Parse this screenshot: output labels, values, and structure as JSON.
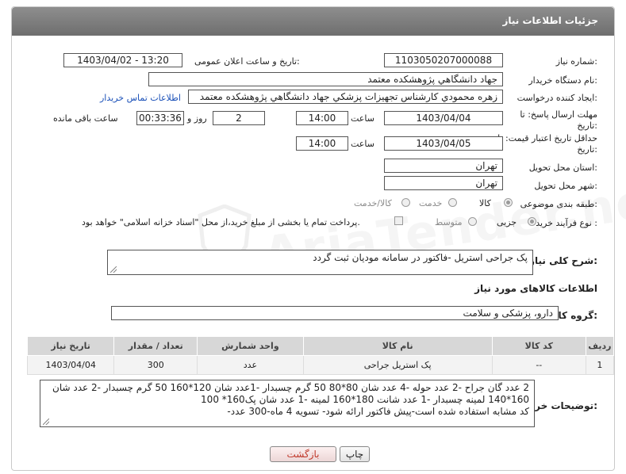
{
  "header": {
    "title": "جزئیات اطلاعات نیاز"
  },
  "form": {
    "need_number": {
      "label": "شماره نیاز:",
      "value": "1103050207000088"
    },
    "announce_datetime": {
      "label": "تاریخ و ساعت اعلان عمومی:",
      "value": "1403/04/02 - 13:20"
    },
    "buyer_org": {
      "label": "نام دستگاه خریدار:",
      "value": "جهاد دانشگاهي پژوهشکده معتمد"
    },
    "requester": {
      "label": "ایجاد کننده درخواست:",
      "value": "زهره محمودي کارشناس تجهیزات پزشکي جهاد دانشگاهي پژوهشکده معتمد",
      "contact_link": "اطلاعات تماس خریدار"
    },
    "reply_deadline": {
      "label_line1": "مهلت ارسال پاسخ: تا",
      "label_line2": "تاریخ:",
      "date": "1403/04/04",
      "time_label": "ساعت",
      "time": "14:00",
      "days": "2",
      "days_label": "روز و",
      "remaining": "00:33:36",
      "remaining_label": "ساعت باقی مانده"
    },
    "price_validity": {
      "label_line1": "حداقل تاریخ اعتبار قیمت: تا",
      "label_line2": "تاریخ:",
      "date": "1403/04/05",
      "time_label": "ساعت",
      "time": "14:00"
    },
    "delivery_province": {
      "label": "استان محل تحویل:",
      "value": "تهران"
    },
    "delivery_city": {
      "label": "شهر محل تحویل:",
      "value": "تهران"
    },
    "subject_class": {
      "label": "طبقه بندی موضوعی:",
      "options": [
        "کالا",
        "خدمت",
        "کالا/خدمت"
      ],
      "selected": "کالا"
    },
    "purchase_process": {
      "label": "نوع فرآیند خرید :",
      "options": [
        "جزیی",
        "متوسط"
      ],
      "selected": "جزیی",
      "payment_note": "پرداخت تمام یا بخشی از مبلغ خرید،از محل \"اسناد خزانه اسلامی\" خواهد بود."
    },
    "general_desc": {
      "label": "شرح کلی نیاز:",
      "value": "پک جراحی استریل -فاکتور در سامانه مودیان ثبت گردد"
    }
  },
  "items_section": {
    "title": "اطلاعات کالاهای مورد نیاز",
    "group_label": "گروه کالا:",
    "group_value": "دارو، پزشکی و سلامت",
    "columns": [
      "ردیف",
      "کد کالا",
      "نام کالا",
      "واحد شمارش",
      "تعداد / مقدار",
      "تاریخ نیاز"
    ],
    "rows": [
      {
        "row": "1",
        "code": "--",
        "name": "پک استریل جراحی",
        "unit": "عدد",
        "qty": "300",
        "date": "1403/04/04"
      }
    ]
  },
  "buyer_notes": {
    "label": "توضیحات خریدار:",
    "lines": [
      "2 عدد گان جراح -2 عدد حوله -4 عدد شان 80*80 50 گرم چسبدار -1عدد شان 120*160 50 گرم چسبدار -2 عدد شان",
      "160*140 لمینه چسبدار -1 عدد شانت 180*160 لمینه -1 عدد شان پک160* 100",
      "کد مشابه استفاده شده است-پیش فاکتور ارائه شود- تسویه 4 ماه-300 عدد-"
    ]
  },
  "buttons": {
    "print": "چاپ",
    "back": "بازگشت"
  },
  "watermark": "AriaTender.neT",
  "colors": {
    "header_bg": "#7a7a7a",
    "link": "#1a50b8",
    "back_button_text": "#c0392b"
  }
}
